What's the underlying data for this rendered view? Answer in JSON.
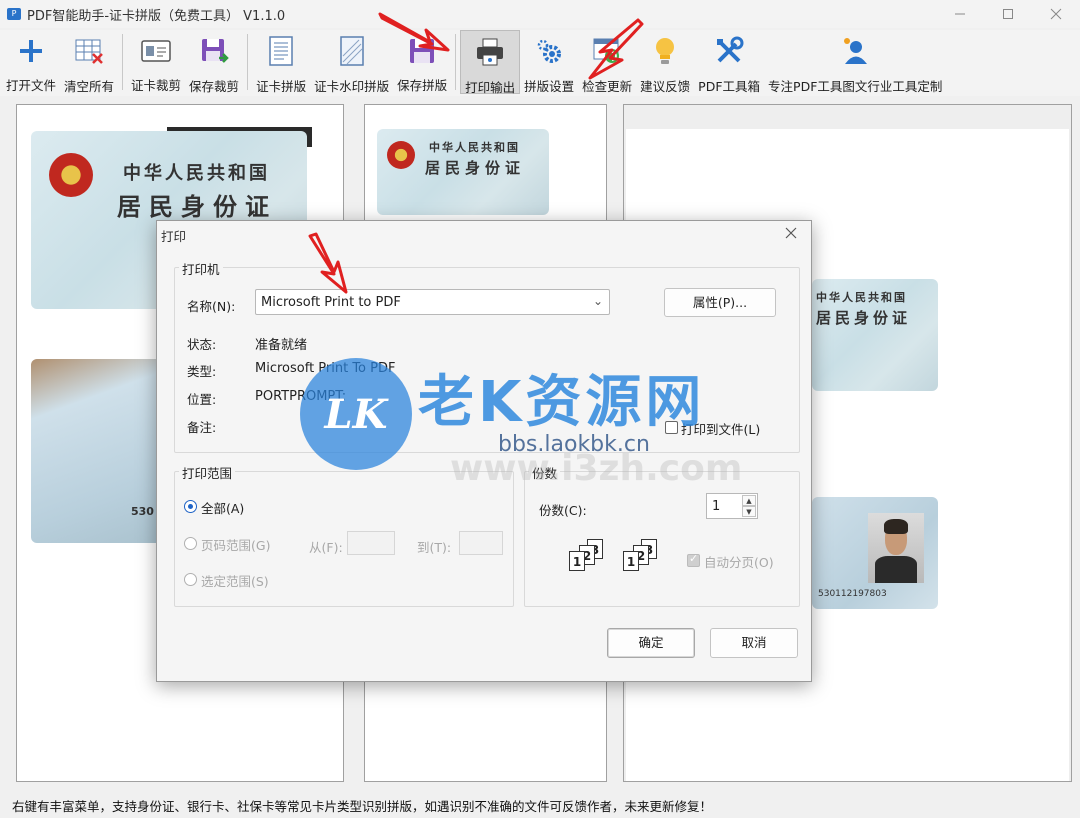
{
  "window": {
    "title": "PDF智能助手-证卡拼版（免费工具） V1.1.0",
    "app_icon_text": "P"
  },
  "toolbar": [
    {
      "label": "打开文件",
      "icon": "plus-icon"
    },
    {
      "label": "清空所有",
      "icon": "clear-grid-icon"
    },
    {
      "label": "证卡裁剪",
      "icon": "id-card-icon"
    },
    {
      "label": "保存裁剪",
      "icon": "save-export-icon"
    },
    {
      "label": "证卡拼版",
      "icon": "document-icon"
    },
    {
      "label": "证卡水印拼版",
      "icon": "watermark-doc-icon"
    },
    {
      "label": "保存拼版",
      "icon": "save-icon"
    },
    {
      "label": "打印输出",
      "icon": "printer-icon"
    },
    {
      "label": "拼版设置",
      "icon": "gear-icon"
    },
    {
      "label": "检查更新",
      "icon": "update-icon"
    },
    {
      "label": "建议反馈",
      "icon": "lightbulb-icon"
    },
    {
      "label": "PDF工具箱",
      "icon": "tools-icon"
    },
    {
      "label": "专注PDF工具图文行业工具定制",
      "icon": "user-icon"
    }
  ],
  "cards": {
    "front_title_1": "中华人民共和国",
    "front_title_2": "居民身份证",
    "back_number": "530112197803",
    "back_number_left": "530"
  },
  "dialog": {
    "title": "打印",
    "printer_group": "打印机",
    "name_label": "名称(N):",
    "name_value": "Microsoft Print to PDF",
    "properties_button": "属性(P)...",
    "status_label": "状态:",
    "status_value": "准备就绪",
    "type_label": "类型:",
    "type_value": "Microsoft Print To PDF",
    "where_label": "位置:",
    "where_value": "PORTPROMPT:",
    "comment_label": "备注:",
    "print_to_file": "打印到文件(L)",
    "range_group": "打印范围",
    "range_all": "全部(A)",
    "range_pages": "页码范围(G)",
    "range_from": "从(F):",
    "range_to": "到(T):",
    "range_selection": "选定范围(S)",
    "copies_group": "份数",
    "copies_label": "份数(C):",
    "copies_value": "1",
    "collate": "自动分页(O)",
    "ok_button": "确定",
    "cancel_button": "取消"
  },
  "watermark": {
    "logo_text": "LK",
    "title": "老K资源网",
    "url": "bbs.laokbk.cn",
    "url2": "www.i3zh.com"
  },
  "status_bar": {
    "text": "右键有丰富菜单，支持身份证、银行卡、社保卡等常见卡片类型识别拼版，如遇识别不准确的文件可反馈作者，未来更新修复！"
  },
  "colors": {
    "accent": "#1e63c6",
    "arrow": "#e02020",
    "watermark": "#2882dc"
  }
}
